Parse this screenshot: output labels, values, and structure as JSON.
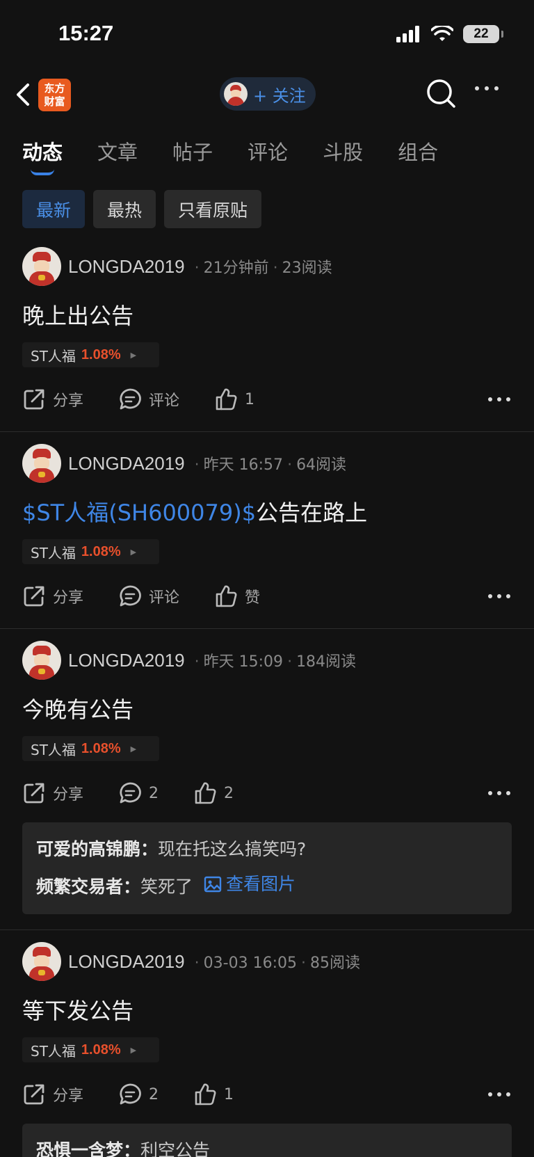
{
  "status_bar": {
    "time": "15:27",
    "battery": "22"
  },
  "nav": {
    "logo_line1": "东方",
    "logo_line2": "财富",
    "follow": "+ 关注"
  },
  "tabs": [
    "动态",
    "文章",
    "帖子",
    "评论",
    "斗股",
    "组合"
  ],
  "filters": [
    "最新",
    "最热",
    "只看原贴"
  ],
  "posts": [
    {
      "author": "LONGDA2019",
      "time": "21分钟前",
      "reads": "23阅读",
      "text": "晚上出公告",
      "cashtag": "",
      "stock": "ST人福",
      "pct": "1.08%",
      "share": "分享",
      "comment": "评论",
      "like": "1"
    },
    {
      "author": "LONGDA2019",
      "time": "昨天 16:57",
      "reads": "64阅读",
      "text": "公告在路上",
      "cashtag": "$ST人福(SH600079)$",
      "stock": "ST人福",
      "pct": "1.08%",
      "share": "分享",
      "comment": "评论",
      "like": "赞"
    },
    {
      "author": "LONGDA2019",
      "time": "昨天 15:09",
      "reads": "184阅读",
      "text": "今晚有公告",
      "cashtag": "",
      "stock": "ST人福",
      "pct": "1.08%",
      "share": "分享",
      "comment": "2",
      "like": "2",
      "comments": [
        {
          "name": "可爱的高锦鹏：",
          "text": "现在托这么搞笑吗?"
        },
        {
          "name": "频繁交易者：",
          "text": "笑死了",
          "link": "查看图片"
        }
      ]
    },
    {
      "author": "LONGDA2019",
      "time": "03-03 16:05",
      "reads": "85阅读",
      "text": "等下发公告",
      "cashtag": "",
      "stock": "ST人福",
      "pct": "1.08%",
      "share": "分享",
      "comment": "2",
      "like": "1",
      "comments": [
        {
          "name": "恐惧一含梦：",
          "text": "利空公告"
        }
      ]
    }
  ],
  "colors": {
    "accent": "#3f86e6",
    "up": "#e8502c",
    "background": "#121212"
  }
}
